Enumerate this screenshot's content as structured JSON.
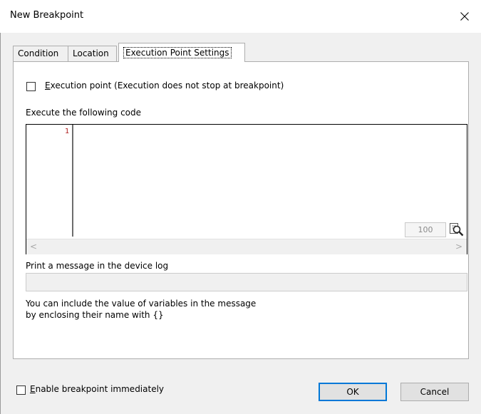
{
  "window": {
    "title": "New Breakpoint",
    "close_icon": "close-icon"
  },
  "tabs": [
    {
      "label": "Condition",
      "active": false
    },
    {
      "label": "Location",
      "active": false
    },
    {
      "label": "Execution Point Settings",
      "active": true
    }
  ],
  "execution_point": {
    "checked": false,
    "mnemonic": "E",
    "label_rest": "xecution point (Execution does not stop at breakpoint)"
  },
  "code": {
    "label": "Execute the following code",
    "line_numbers": [
      "1"
    ],
    "zoom": "100",
    "zoom_icon": "magnifier-icon",
    "scroll_left": "<",
    "scroll_right": ">"
  },
  "message": {
    "label": "Print a message in the device log",
    "value": "",
    "hint_line1": "You can include the value of variables in the message",
    "hint_line2": "by enclosing their name with {}"
  },
  "enable": {
    "checked": false,
    "mnemonic": "E",
    "label_rest": "nable breakpoint immediately"
  },
  "buttons": {
    "ok": "OK",
    "cancel": "Cancel"
  }
}
